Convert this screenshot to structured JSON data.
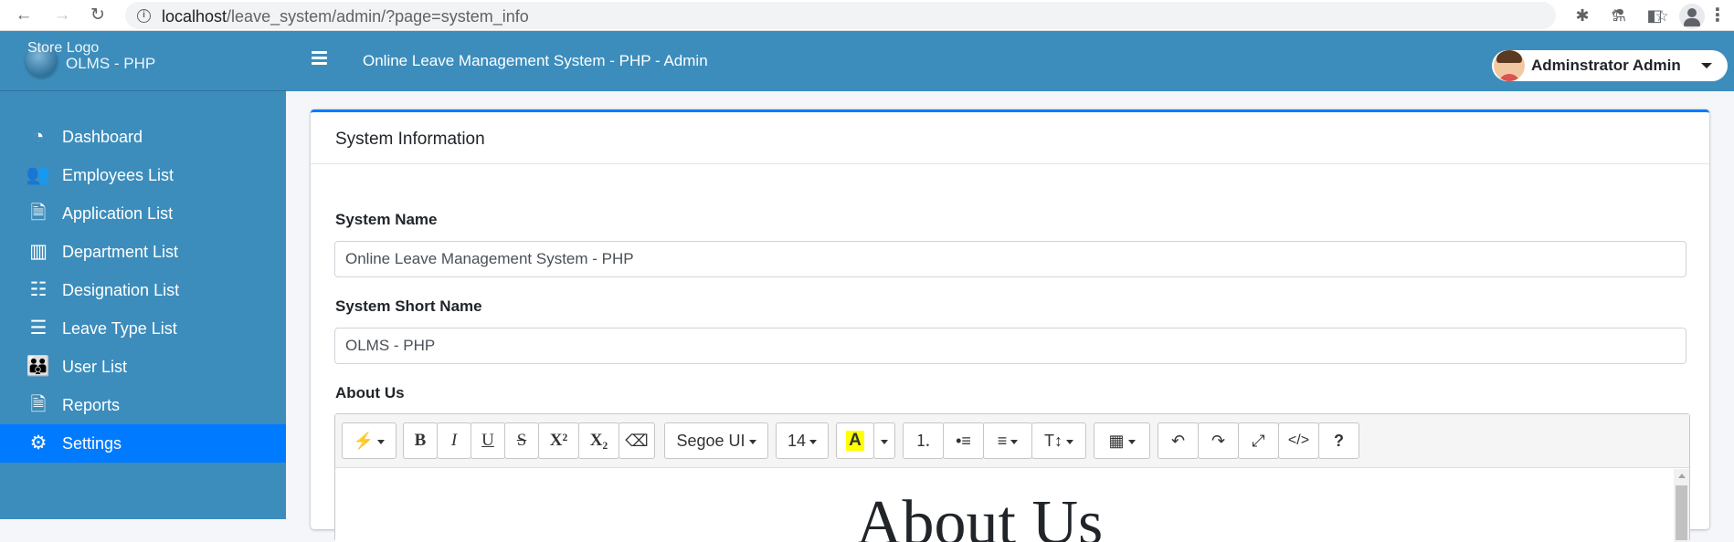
{
  "browser": {
    "url_host": "localhost",
    "url_path": "/leave_system/admin/?page=system_info",
    "back_glyph": "←",
    "forward_glyph": "→",
    "reload_glyph": "↻",
    "share_glyph": "⇪",
    "star_glyph": "☆",
    "puzzle_glyph": "✱",
    "flask_glyph": "⚗",
    "panel_glyph": "◧",
    "menu_glyph": "⋮"
  },
  "sidebar": {
    "logo_alt": "Store Logo",
    "brand_text": "OLMS - PHP",
    "items": [
      {
        "label": "Dashboard",
        "icon": "tachometer-icon",
        "glyph": "◔"
      },
      {
        "label": "Employees List",
        "icon": "users-icon",
        "glyph": "👥"
      },
      {
        "label": "Application List",
        "icon": "file-icon",
        "glyph": "🗎"
      },
      {
        "label": "Department List",
        "icon": "building-icon",
        "glyph": "▥"
      },
      {
        "label": "Designation List",
        "icon": "table-list-icon",
        "glyph": "☷"
      },
      {
        "label": "Leave Type List",
        "icon": "list-icon",
        "glyph": "☰"
      },
      {
        "label": "User List",
        "icon": "users-group-icon",
        "glyph": "👪"
      },
      {
        "label": "Reports",
        "icon": "report-file-icon",
        "glyph": "🗎"
      },
      {
        "label": "Settings",
        "icon": "cogs-icon",
        "glyph": "⚙"
      }
    ],
    "active_index": 8
  },
  "header": {
    "title": "Online Leave Management System - PHP - Admin",
    "user_name": "Adminstrator Admin"
  },
  "card": {
    "title": "System Information",
    "fields": {
      "system_name_label": "System Name",
      "system_name_value": "Online Leave Management System - PHP",
      "short_name_label": "System Short Name",
      "short_name_value": "OLMS - PHP",
      "about_label": "About Us"
    }
  },
  "editor": {
    "font_family": "Segoe UI",
    "font_size": "14",
    "highlight_letter": "A",
    "bold": "B",
    "italic": "I",
    "underline": "U",
    "strike": "S",
    "superscript": "X²",
    "subscript": "X₂",
    "magic_glyph": "⚡",
    "eraser_glyph": "⌫",
    "ol_glyph": "⒈",
    "ul_glyph": "•≡",
    "align_glyph": "≡",
    "height_glyph": "T↕",
    "table_glyph": "▦",
    "undo_glyph": "↶",
    "redo_glyph": "↷",
    "fullscreen_glyph": "⤢",
    "code_glyph": "</>",
    "help_glyph": "?",
    "content_heading": "About Us"
  },
  "colors": {
    "primary": "#3c8dbc",
    "active": "#007bff"
  }
}
